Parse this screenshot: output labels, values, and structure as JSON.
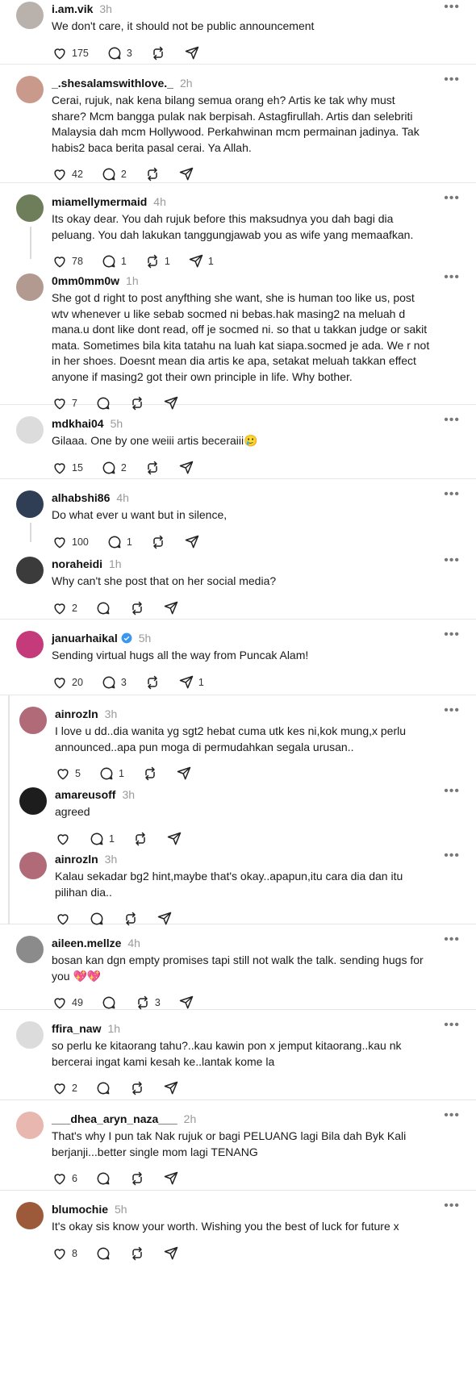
{
  "posts": [
    {
      "username": "i.am.vik",
      "time": "3h",
      "text": "We don't care, it should not be public announcement",
      "likes": "175",
      "replies": "3",
      "reposts": "",
      "shares": "",
      "avatar_color": "#b9b1ac"
    },
    {
      "username": "_.shesalamswithlove._",
      "time": "2h",
      "text": "Cerai, rujuk, nak kena bilang semua orang eh? Artis ke tak why must share? Mcm bangga pulak nak berpisah. Astagfirullah. Artis dan selebriti Malaysia dah mcm Hollywood. Perkahwinan mcm permainan jadinya. Tak habis2 baca berita pasal cerai. Ya Allah.",
      "likes": "42",
      "replies": "2",
      "reposts": "",
      "shares": "",
      "avatar_color": "#c99a8c"
    },
    {
      "username": "miamellymermaid",
      "time": "4h",
      "text": "Its okay dear. You dah rujuk before this maksudnya you dah bagi dia peluang. You dah lakukan tanggungjawab you as wife yang memaafkan.",
      "likes": "78",
      "replies": "1",
      "reposts": "1",
      "shares": "1",
      "avatar_color": "#6f7e5a"
    },
    {
      "username": "0mm0mm0w",
      "time": "1h",
      "text": "She got d right to post anyfthing she want, she is human too like us, post wtv whenever u like sebab socmed ni bebas.hak masing2 na meluah d mana.u dont like dont read, off je socmed ni. so that u takkan judge or sakit mata. Sometimes bila kita tatahu na luah kat siapa.socmed je ada. We r not in her shoes. Doesnt mean dia artis ke apa, setakat meluah takkan effect anyone if masing2 got their own principle in life. Why bother.",
      "likes": "7",
      "replies": "",
      "reposts": "",
      "shares": "",
      "avatar_color": "#b39a90"
    },
    {
      "username": "mdkhai04",
      "time": "5h",
      "text": "Gilaaa. One by one weiii artis beceraiii🥲",
      "likes": "15",
      "replies": "2",
      "reposts": "",
      "shares": "",
      "avatar_color": "#dcdcdc"
    },
    {
      "username": "alhabshi86",
      "time": "4h",
      "text": "Do what ever u want but in silence,",
      "likes": "100",
      "replies": "1",
      "reposts": "",
      "shares": "",
      "avatar_color": "#2f3e55"
    },
    {
      "username": "noraheidi",
      "time": "1h",
      "text": "Why can't she post that on her social media?",
      "likes": "2",
      "replies": "",
      "reposts": "",
      "shares": "",
      "avatar_color": "#3b3b3b"
    },
    {
      "username": "januarhaikal",
      "time": "5h",
      "text": "Sending virtual hugs all the way from Puncak Alam!",
      "likes": "20",
      "replies": "3",
      "reposts": "",
      "shares": "1",
      "avatar_color": "#c43a7a"
    },
    {
      "username": "ainrozln",
      "time": "3h",
      "text": "I love u dd..dia wanita yg sgt2 hebat cuma utk kes ni,kok mung,x perlu announced..apa pun moga di permudahkan segala urusan..",
      "likes": "5",
      "replies": "1",
      "reposts": "",
      "shares": "",
      "avatar_color": "#b06a78"
    },
    {
      "username": "amareusoff",
      "time": "3h",
      "text": "agreed",
      "likes": "",
      "replies": "1",
      "reposts": "",
      "shares": "",
      "avatar_color": "#1d1d1d"
    },
    {
      "username": "ainrozln",
      "time": "3h",
      "text": "Kalau sekadar bg2 hint,maybe that's okay..apapun,itu cara dia dan itu pilihan dia..",
      "likes": "",
      "replies": "",
      "reposts": "",
      "shares": "",
      "avatar_color": "#b06a78"
    },
    {
      "username": "aileen.mellze",
      "time": "4h",
      "text": "bosan kan dgn empty promises tapi still not walk the talk. sending hugs for you 💖💖",
      "likes": "49",
      "replies": "",
      "reposts": "3",
      "shares": "",
      "avatar_color": "#8b8b8b"
    },
    {
      "username": "ffira_naw",
      "time": "1h",
      "text": "so perlu ke kitaorang tahu?..kau kawin pon x jemput kitaorang..kau nk bercerai ingat kami kesah ke..lantak kome la",
      "likes": "2",
      "replies": "",
      "reposts": "",
      "shares": "",
      "avatar_color": "#dcdcdc"
    },
    {
      "username": "___dhea_aryn_naza___",
      "time": "2h",
      "text": "That's why I pun tak Nak rujuk or bagi PELUANG lagi Bila dah Byk Kali berjanji...better single mom lagi TENANG",
      "likes": "6",
      "replies": "",
      "reposts": "",
      "shares": "",
      "avatar_color": "#e8b7b0"
    },
    {
      "username": "blumochie",
      "time": "5h",
      "text": "It's okay sis know your worth. Wishing you the best of luck for future x",
      "likes": "8",
      "replies": "",
      "reposts": "",
      "shares": "",
      "avatar_color": "#9c5a3a"
    }
  ],
  "icons": {
    "like": "heart-icon",
    "reply": "comment-icon",
    "repost": "repost-icon",
    "share": "send-icon",
    "more": "more-icon",
    "verified": "verified-badge-icon"
  },
  "colors": {
    "verified": "#3897f0",
    "muted": "#9a9a9a",
    "separator": "#e7e7e7"
  }
}
